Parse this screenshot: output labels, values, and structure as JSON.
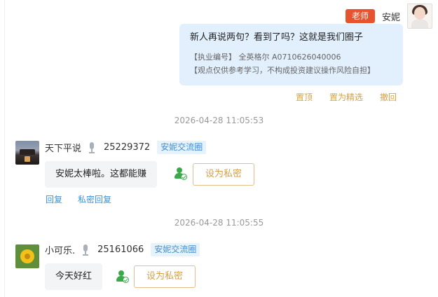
{
  "teacher_message": {
    "role_badge": "老师",
    "name": "安妮",
    "text": "新人再说两句？看到了吗？这就是我们圈子",
    "license_line": "【执业编号】 全英格尔 A0710626040006",
    "disclaimer_line": "【观点仅供参考学习，不构成投资建议操作风险自担】",
    "actions": {
      "pin": "置顶",
      "feature": "置为精选",
      "withdraw": "撤回"
    }
  },
  "messages": [
    {
      "timestamp": "2026-04-28 11:05:53",
      "username": "天下平说",
      "user_id": "25229372",
      "group_tag": "安妮交流圈",
      "text": "安妮太棒啦。这都能赚",
      "set_private_label": "设为私密",
      "reply_label": "回复",
      "private_reply_label": "私密回复"
    },
    {
      "timestamp": "2026-04-28 11:05:55",
      "username": "小可乐.",
      "user_id": "25161066",
      "group_tag": "安妮交流圈",
      "text": "今天好红",
      "set_private_label": "设为私密"
    }
  ],
  "colors": {
    "role_badge": "#e8532f",
    "teacher_bubble": "#e2effd",
    "action_gold": "#d4a046",
    "link_blue": "#3d8fd6",
    "verified_green": "#3aa94a"
  }
}
